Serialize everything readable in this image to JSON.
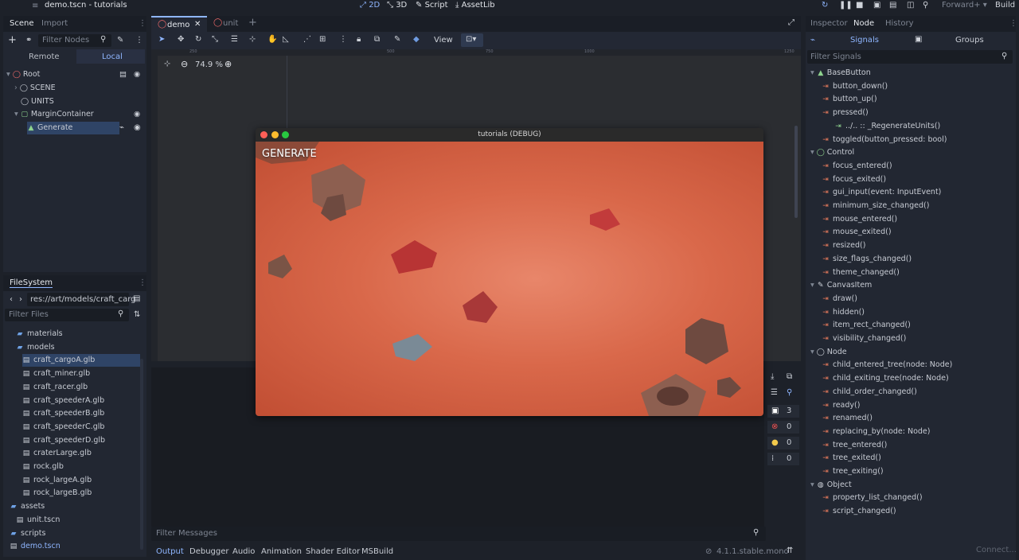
{
  "window": {
    "title": "demo.tscn - tutorials"
  },
  "main_modes": [
    {
      "label": "2D",
      "active": true
    },
    {
      "label": "3D"
    },
    {
      "label": "Script"
    },
    {
      "label": "AssetLib"
    }
  ],
  "renderer": "Forward+",
  "build_label": "Build",
  "scene_dock": {
    "tabs": [
      "Scene",
      "Import"
    ],
    "filter_placeholder": "Filter Nodes",
    "remote": "Remote",
    "local": "Local",
    "tree": [
      {
        "label": "Root",
        "depth": 0
      },
      {
        "label": "SCENE",
        "depth": 1
      },
      {
        "label": "UNITS",
        "depth": 1
      },
      {
        "label": "MarginContainer",
        "depth": 1
      },
      {
        "label": "Generate",
        "depth": 2,
        "selected": true
      }
    ]
  },
  "filesystem": {
    "title": "FileSystem",
    "path": "res://art/models/craft_carg",
    "filter_placeholder": "Filter Files",
    "items": [
      {
        "label": "materials",
        "type": "folder",
        "depth": 2
      },
      {
        "label": "models",
        "type": "folder",
        "depth": 2
      },
      {
        "label": "craft_cargoA.glb",
        "type": "file",
        "depth": 3,
        "selected": true
      },
      {
        "label": "craft_miner.glb",
        "type": "file",
        "depth": 3
      },
      {
        "label": "craft_racer.glb",
        "type": "file",
        "depth": 3
      },
      {
        "label": "craft_speederA.glb",
        "type": "file",
        "depth": 3
      },
      {
        "label": "craft_speederB.glb",
        "type": "file",
        "depth": 3
      },
      {
        "label": "craft_speederC.glb",
        "type": "file",
        "depth": 3
      },
      {
        "label": "craft_speederD.glb",
        "type": "file",
        "depth": 3
      },
      {
        "label": "craterLarge.glb",
        "type": "file",
        "depth": 3
      },
      {
        "label": "rock.glb",
        "type": "file",
        "depth": 3
      },
      {
        "label": "rock_largeA.glb",
        "type": "file",
        "depth": 3
      },
      {
        "label": "rock_largeB.glb",
        "type": "file",
        "depth": 3
      },
      {
        "label": "assets",
        "type": "folder",
        "depth": 1
      },
      {
        "label": "unit.tscn",
        "type": "scene",
        "depth": 2
      },
      {
        "label": "scripts",
        "type": "folder",
        "depth": 1
      },
      {
        "label": "demo.tscn",
        "type": "scene",
        "depth": 1
      }
    ]
  },
  "editor_tabs": [
    "demo",
    "unit"
  ],
  "toolbar": {
    "view_label": "View",
    "zoom": "74.9 %",
    "ruler_ticks": [
      "250",
      "500",
      "750",
      "1000",
      "1250"
    ]
  },
  "game_window": {
    "title": "tutorials (DEBUG)",
    "button_label": "GENERATE"
  },
  "output": {
    "filter_placeholder": "Filter Messages",
    "tabs": [
      "Output",
      "Debugger",
      "Audio",
      "Animation",
      "Shader Editor",
      "MSBuild"
    ],
    "version": "4.1.1.stable.mono",
    "counts": [
      "3",
      "0",
      "0",
      "0"
    ]
  },
  "inspector": {
    "tabs": [
      "Inspector",
      "Node",
      "History"
    ],
    "sub_tabs": [
      "Signals",
      "Groups"
    ],
    "filter_placeholder": "Filter Signals",
    "connect": "Connect...",
    "groups": [
      {
        "name": "BaseButton",
        "signals": [
          {
            "label": "button_down()"
          },
          {
            "label": "button_up()"
          },
          {
            "label": "pressed()",
            "connection": "../.. :: _RegenerateUnits()"
          },
          {
            "label": "toggled(button_pressed: bool)"
          }
        ]
      },
      {
        "name": "Control",
        "signals": [
          {
            "label": "focus_entered()"
          },
          {
            "label": "focus_exited()"
          },
          {
            "label": "gui_input(event: InputEvent)"
          },
          {
            "label": "minimum_size_changed()"
          },
          {
            "label": "mouse_entered()"
          },
          {
            "label": "mouse_exited()"
          },
          {
            "label": "resized()"
          },
          {
            "label": "size_flags_changed()"
          },
          {
            "label": "theme_changed()"
          }
        ]
      },
      {
        "name": "CanvasItem",
        "signals": [
          {
            "label": "draw()"
          },
          {
            "label": "hidden()"
          },
          {
            "label": "item_rect_changed()"
          },
          {
            "label": "visibility_changed()"
          }
        ]
      },
      {
        "name": "Node",
        "signals": [
          {
            "label": "child_entered_tree(node: Node)"
          },
          {
            "label": "child_exiting_tree(node: Node)"
          },
          {
            "label": "child_order_changed()"
          },
          {
            "label": "ready()"
          },
          {
            "label": "renamed()"
          },
          {
            "label": "replacing_by(node: Node)"
          },
          {
            "label": "tree_entered()"
          },
          {
            "label": "tree_exited()"
          },
          {
            "label": "tree_exiting()"
          }
        ]
      },
      {
        "name": "Object",
        "signals": [
          {
            "label": "property_list_changed()"
          },
          {
            "label": "script_changed()"
          }
        ]
      }
    ]
  }
}
